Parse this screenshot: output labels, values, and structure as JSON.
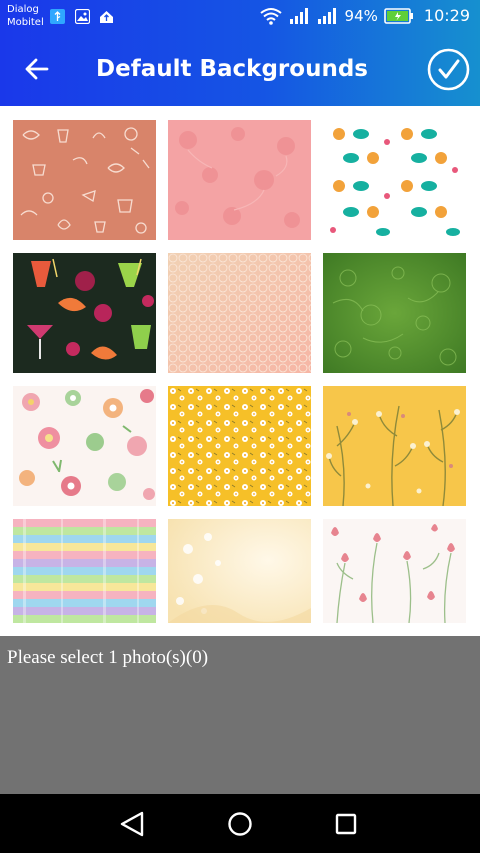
{
  "status_bar": {
    "carrier_line1": "Dialog",
    "carrier_line2": "Mobitel",
    "battery": "94%",
    "time": "10:29",
    "icons": [
      "usb-icon",
      "image-icon",
      "upload-icon",
      "wifi-icon",
      "signal-icon",
      "signal-icon",
      "battery-icon"
    ]
  },
  "app_bar": {
    "title": "Default Backgrounds",
    "back_icon": "arrow-left-icon",
    "confirm_icon": "check-circle-icon"
  },
  "backgrounds": [
    {
      "name": "coffee-doodles"
    },
    {
      "name": "pink-floral"
    },
    {
      "name": "cats-and-fish"
    },
    {
      "name": "cocktails"
    },
    {
      "name": "beige-lattice"
    },
    {
      "name": "green-floral"
    },
    {
      "name": "pastel-flowers"
    },
    {
      "name": "yellow-daisies"
    },
    {
      "name": "yellow-branches"
    },
    {
      "name": "rainbow-stripes"
    },
    {
      "name": "cream-watercolor"
    },
    {
      "name": "pink-tulips"
    }
  ],
  "footer": {
    "hint": "Please select 1 photo(s)(0)"
  },
  "nav_bar": {
    "icons": [
      "back-triangle-icon",
      "home-circle-icon",
      "recents-square-icon"
    ]
  },
  "colors": {
    "app_bar_start": "#1a38ea",
    "app_bar_end": "#1690cf",
    "footer_bg": "#727272",
    "nav_bg": "#000000"
  }
}
